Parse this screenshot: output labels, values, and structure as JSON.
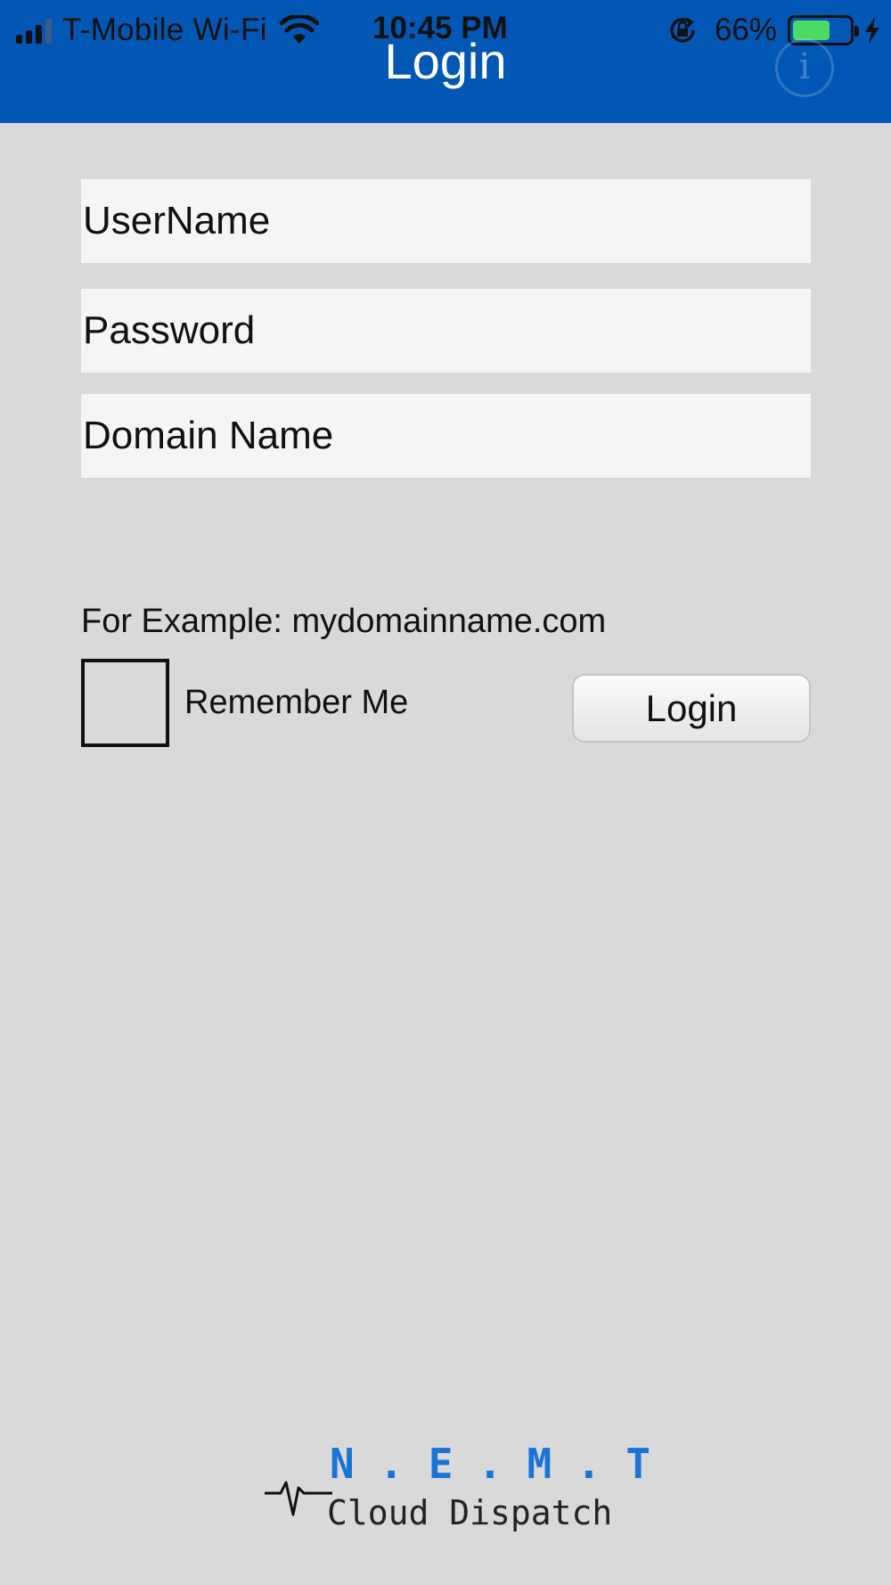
{
  "status_bar": {
    "carrier": "T-Mobile Wi-Fi",
    "time": "10:45 PM",
    "battery_percent": "66%",
    "battery_level": 0.66,
    "battery_color": "#4cd964"
  },
  "nav": {
    "title": "Login",
    "background": "#0257b4",
    "info_icon": "info-icon",
    "info_glyph": "i"
  },
  "form": {
    "username_placeholder": "UserName",
    "password_placeholder": "Password",
    "domain_placeholder": "Domain Name",
    "domain_example": "For Example: mydomainname.com",
    "remember_label": "Remember Me",
    "remember_checked": false,
    "login_label": "Login"
  },
  "logo": {
    "title": "N.E.M.T",
    "subtitle": "Cloud Dispatch",
    "accent": "#1a73d6"
  }
}
